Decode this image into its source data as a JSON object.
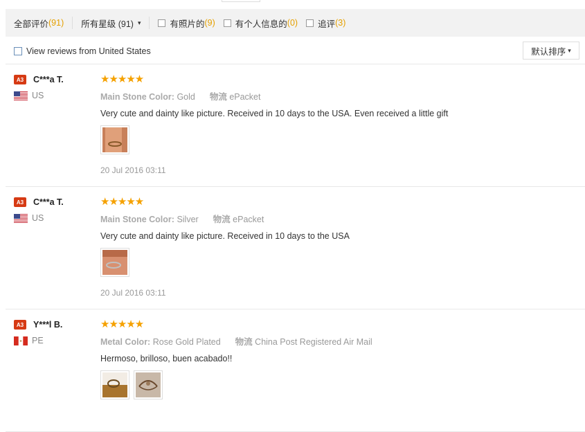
{
  "filters": {
    "all_label": "全部评价",
    "all_count": "(91)",
    "stars_label": "所有星级 (91)",
    "photo_label": "有照片的",
    "photo_count": "(9)",
    "personal_label": "有个人信息的",
    "personal_count": "(0)",
    "followup_label": "追评",
    "followup_count": "(3)"
  },
  "country_filter": {
    "label": "View reviews from United States"
  },
  "sort": {
    "label": "默认排序"
  },
  "colors": {
    "accent": "#e5a000",
    "star": "#f5a100",
    "level_badge": "#d63a14"
  },
  "reviews": [
    {
      "level": "A3",
      "name": "C***a T.",
      "country": "US",
      "flag": "us-flag-icon",
      "stars": "★★★★★",
      "attr1_key": "Main Stone Color:",
      "attr1_val": "Gold",
      "attr2_key": "物流",
      "attr2_val": "ePacket",
      "text": "Very cute and dainty like picture. Received in 10 days to the USA. Even received a little gift",
      "date": "20 Jul 2016 03:11"
    },
    {
      "level": "A3",
      "name": "C***a T.",
      "country": "US",
      "flag": "us-flag-icon",
      "stars": "★★★★★",
      "attr1_key": "Main Stone Color:",
      "attr1_val": "Silver",
      "attr2_key": "物流",
      "attr2_val": "ePacket",
      "text": "Very cute and dainty like picture. Received in 10 days to the USA",
      "date": "20 Jul 2016 03:11"
    },
    {
      "level": "A3",
      "name": "Y***l B.",
      "country": "PE",
      "flag": "pe-flag-icon",
      "stars": "★★★★★",
      "attr1_key": "Metal Color:",
      "attr1_val": "Rose Gold Plated",
      "attr2_key": "物流",
      "attr2_val": "China Post Registered Air Mail",
      "text": "Hermoso, brilloso, buen acabado!!"
    }
  ]
}
